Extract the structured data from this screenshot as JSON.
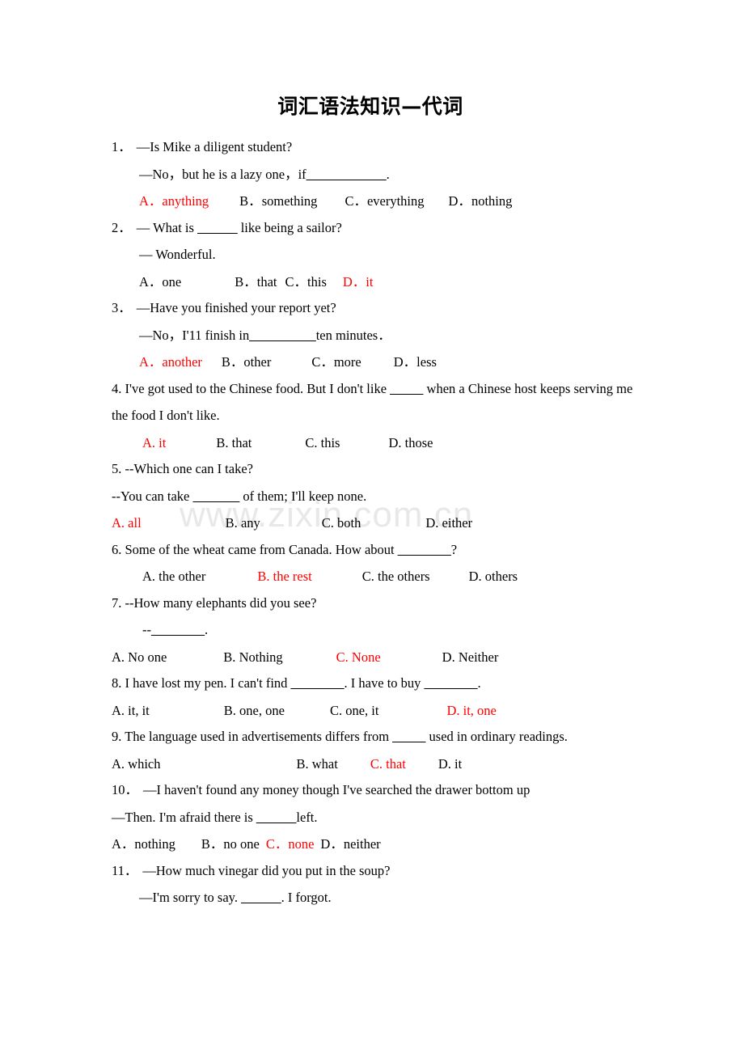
{
  "document": {
    "title": "词汇语法知识—代词",
    "watermark": "www.zixin.com.cn",
    "answer_color": "#ff0000",
    "text_color": "#000000",
    "background": "#ffffff"
  },
  "questions": [
    {
      "number": "1．",
      "stem": "—Is Mike a diligent student?",
      "reply_pre": "—No，but he is a lazy one，if",
      "reply_blank": "____________",
      "reply_post": ".",
      "options_line": "A．anything        B．something      C．everything      D．nothing",
      "options": [
        {
          "letter": "A．",
          "text": "anything",
          "correct": true
        },
        {
          "letter": "B．",
          "text": "something",
          "correct": false
        },
        {
          "letter": "C．",
          "text": "everything",
          "correct": false
        },
        {
          "letter": "D．",
          "text": "nothing",
          "correct": false
        }
      ],
      "answer": "A"
    },
    {
      "number": "2．",
      "stem_pre": "— What is ",
      "stem_blank": "______",
      "stem_post": " like being a sailor?",
      "reply": "— Wonderful.",
      "options": [
        {
          "letter": "A．",
          "text": "one",
          "correct": false
        },
        {
          "letter": "B．",
          "text": "that",
          "correct": false
        },
        {
          "letter": "C．",
          "text": "this",
          "correct": false
        },
        {
          "letter": "D．",
          "text": "it",
          "correct": true
        }
      ],
      "answer": "D"
    },
    {
      "number": "3．",
      "stem": "—Have you finished your report yet?",
      "reply_pre": "—No，I'11 finish in",
      "reply_blank": "__________",
      "reply_post": "ten minutes．",
      "options": [
        {
          "letter": "A．",
          "text": "another",
          "correct": true
        },
        {
          "letter": "B．",
          "text": "other",
          "correct": false
        },
        {
          "letter": "C．",
          "text": "more",
          "correct": false
        },
        {
          "letter": "D．",
          "text": "less",
          "correct": false
        }
      ],
      "answer": "A"
    },
    {
      "number": "4.",
      "stem_pre": "4. I've got used to the Chinese food. But I don't like ",
      "stem_blank": "_____",
      "stem_post": " when a Chinese host keeps serving me",
      "stem_line2": "the food I don't like.",
      "options": [
        {
          "letter": "A.",
          "text": "it",
          "correct": true
        },
        {
          "letter": "B.",
          "text": "that",
          "correct": false
        },
        {
          "letter": "C.",
          "text": "this",
          "correct": false
        },
        {
          "letter": "D.",
          "text": "those",
          "correct": false
        }
      ],
      "answer": "A"
    },
    {
      "number": "5.",
      "stem": "5. --Which one can I take?",
      "reply_pre": "--You can take ",
      "reply_blank": "_______",
      "reply_post": " of them; I'll keep none.",
      "options": [
        {
          "letter": "A.",
          "text": "all",
          "correct": true
        },
        {
          "letter": "B.",
          "text": "any",
          "correct": false
        },
        {
          "letter": "C.",
          "text": "both",
          "correct": false
        },
        {
          "letter": "D.",
          "text": "either",
          "correct": false
        }
      ],
      "answer": "A"
    },
    {
      "number": "6.",
      "stem_pre": "6. Some of the wheat came from Canada. How about ",
      "stem_blank": "________",
      "stem_post": "?",
      "options": [
        {
          "letter": "A.",
          "text": "the other",
          "correct": false
        },
        {
          "letter": "B.",
          "text": "the rest",
          "correct": true
        },
        {
          "letter": "C.",
          "text": "the others",
          "correct": false
        },
        {
          "letter": "D.",
          "text": "others",
          "correct": false
        }
      ],
      "answer": "B"
    },
    {
      "number": "7.",
      "stem": "7. --How many elephants did you see?",
      "reply_pre": "--",
      "reply_blank": "________",
      "reply_post": ".",
      "options": [
        {
          "letter": "A.",
          "text": "No one",
          "correct": false
        },
        {
          "letter": "B.",
          "text": "Nothing",
          "correct": false
        },
        {
          "letter": "C.",
          "text": "None",
          "correct": true
        },
        {
          "letter": "D.",
          "text": "Neither",
          "correct": false
        }
      ],
      "answer": "C"
    },
    {
      "number": "8.",
      "stem_pre": "8. I have lost my pen. I can't find ",
      "stem_blank": "________",
      "stem_mid": ". I have to buy ",
      "stem_blank2": "________",
      "stem_post": ".",
      "options": [
        {
          "letter": "A.",
          "text": "it, it",
          "correct": false
        },
        {
          "letter": "B.",
          "text": "one, one",
          "correct": false
        },
        {
          "letter": "C.",
          "text": "one, it",
          "correct": false
        },
        {
          "letter": "D.",
          "text": "it, one",
          "correct": true
        }
      ],
      "answer": "D"
    },
    {
      "number": "9.",
      "stem_pre": "9. The language used in advertisements differs from ",
      "stem_blank": "_____",
      "stem_post": " used in ordinary readings.",
      "options": [
        {
          "letter": "A.",
          "text": "which",
          "correct": false
        },
        {
          "letter": "B.",
          "text": "what",
          "correct": false
        },
        {
          "letter": "C.",
          "text": "that",
          "correct": true
        },
        {
          "letter": "D.",
          "text": "it",
          "correct": false
        }
      ],
      "answer": "C"
    },
    {
      "number": "10．",
      "stem": "—I haven't found any money though I've searched the drawer bottom up",
      "reply_pre": "—Then. I'm afraid there is ",
      "reply_blank": "______",
      "reply_post": "left.",
      "options": [
        {
          "letter": "A．",
          "text": "nothing",
          "correct": false
        },
        {
          "letter": "B．",
          "text": "no one",
          "correct": false
        },
        {
          "letter": "C．",
          "text": "none",
          "correct": true
        },
        {
          "letter": "D．",
          "text": "neither",
          "correct": false
        }
      ],
      "answer": "C"
    },
    {
      "number": "11．",
      "stem": "—How much vinegar did you put in the soup?",
      "reply_pre": "—I'm sorry to say. ",
      "reply_blank": "______",
      "reply_post": ". I forgot.",
      "options": [],
      "answer": ""
    }
  ]
}
